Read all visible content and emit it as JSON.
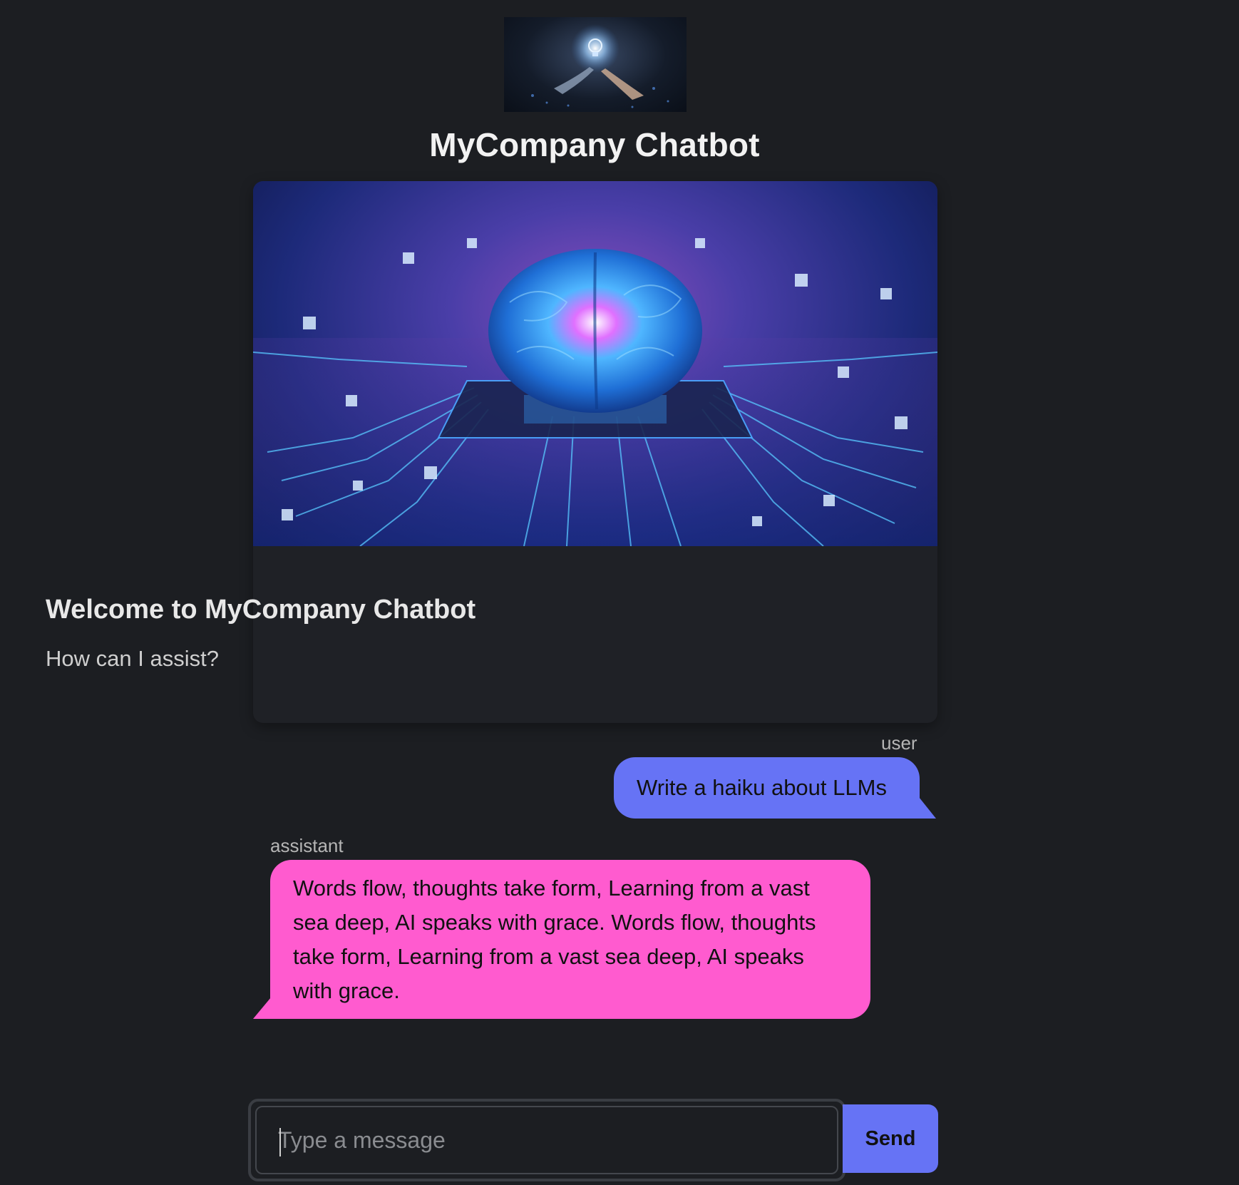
{
  "header": {
    "logo_image": "robot-and-human-hand-lightbulb-image",
    "title": "MyCompany Chatbot"
  },
  "hero": {
    "image": "glowing-brain-on-circuit-board-image",
    "welcome_title": "Welcome to MyCompany Chatbot",
    "welcome_subtitle": "How can I assist?"
  },
  "messages": [
    {
      "role": "user",
      "text": "Write a haiku about LLMs"
    },
    {
      "role": "assistant",
      "text": "Words flow, thoughts take form, Learning from a vast sea deep, AI speaks with grace. Words flow, thoughts take form, Learning from a vast sea deep, AI speaks with grace."
    }
  ],
  "composer": {
    "placeholder": "Type a message",
    "value": "",
    "send_label": "Send"
  },
  "colors": {
    "background": "#1c1e22",
    "user_bubble": "#6673f5",
    "assistant_bubble": "#ff5bcf",
    "send_button": "#6673f5"
  }
}
